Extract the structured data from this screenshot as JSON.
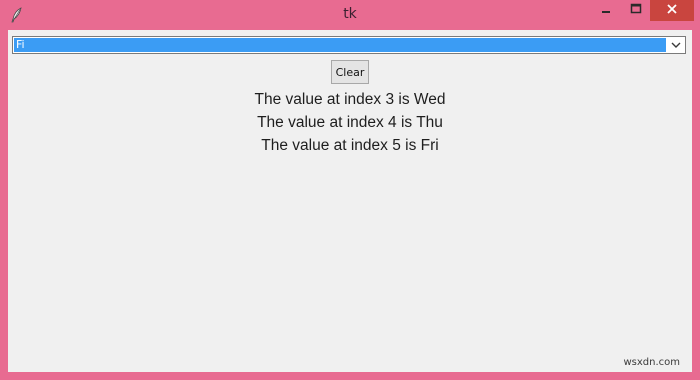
{
  "window": {
    "title": "tk"
  },
  "combobox": {
    "selected": "Fi"
  },
  "button": {
    "clear_label": "Clear"
  },
  "output": {
    "lines": [
      "The value at index 3 is Wed",
      "The value at index 4 is Thu",
      "The value at index 5 is Fri"
    ]
  },
  "watermark": "wsxdn.com",
  "colors": {
    "frame": "#e86b91",
    "client": "#f0f0f0",
    "selection": "#3b9cf4",
    "close": "#c9453f"
  },
  "icons": [
    "feather-icon",
    "minimize-icon",
    "maximize-icon",
    "close-icon",
    "chevron-down-icon"
  ]
}
